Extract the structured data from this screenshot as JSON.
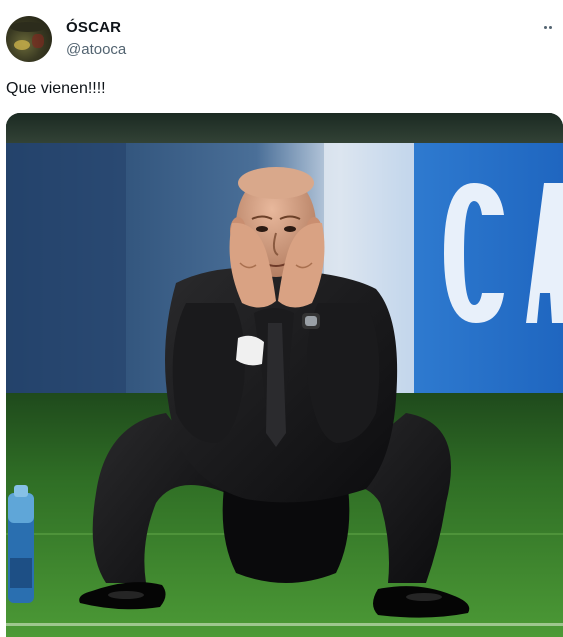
{
  "author": {
    "display_name": "ÓSCAR",
    "handle": "@atooca",
    "avatar_icon": "avatar-photo"
  },
  "tweet": {
    "text": "Que vienen!!!!"
  },
  "media": {
    "icon": "crouching-coach-photo"
  },
  "actions": {
    "more_icon": "more-options-icon"
  },
  "colors": {
    "text_primary": "#0f1419",
    "text_secondary": "#536471",
    "pitch_green": "#3f8a2e",
    "board_blue": "#2d78c8"
  }
}
